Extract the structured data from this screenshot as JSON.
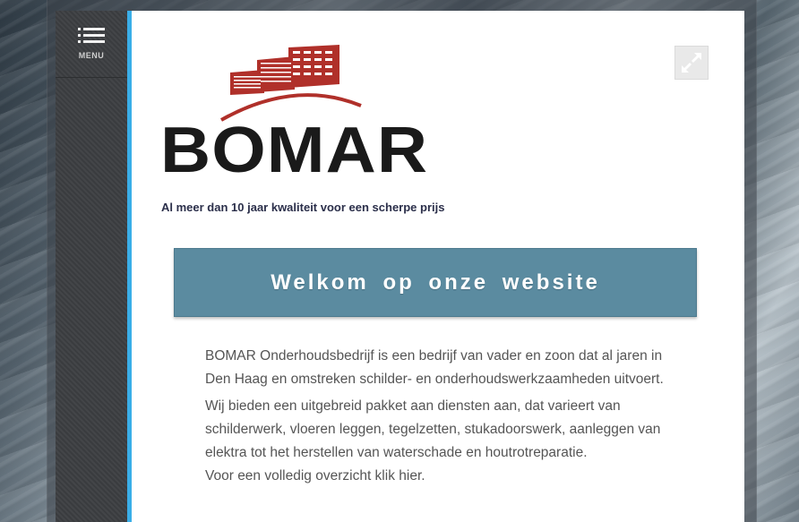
{
  "sidebar": {
    "menu_label": "MENU"
  },
  "logo": {
    "wordmark": "BOMAR",
    "brand_color": "#b0302a"
  },
  "header": {
    "tagline": "Al meer dan 10 jaar kwaliteit voor een scherpe prijs"
  },
  "main": {
    "welcome_title": "Welkom op onze website",
    "paragraph_1": "BOMAR Onderhoudsbedrijf is een bedrijf van vader en zoon dat al jaren in Den Haag en omstreken schilder- en onderhoudswerkzaamheden uitvoert.",
    "paragraph_2": "Wij bieden een uitgebreid pakket aan diensten aan, dat varieert van schilderwerk, vloeren leggen, tegelzetten, stukadoorswerk, aanleggen van elektra tot het herstellen van waterschade en houtrotreparatie.",
    "paragraph_3_prefix": "Voor een volledig overzicht klik ",
    "paragraph_3_link": "hier",
    "paragraph_3_suffix": "."
  },
  "colors": {
    "accent": "#3aaee8",
    "welcome_bg": "#5b8ba0",
    "sidebar_bg": "#3d3f42"
  },
  "icons": [
    "menu-icon",
    "fullscreen-icon"
  ]
}
